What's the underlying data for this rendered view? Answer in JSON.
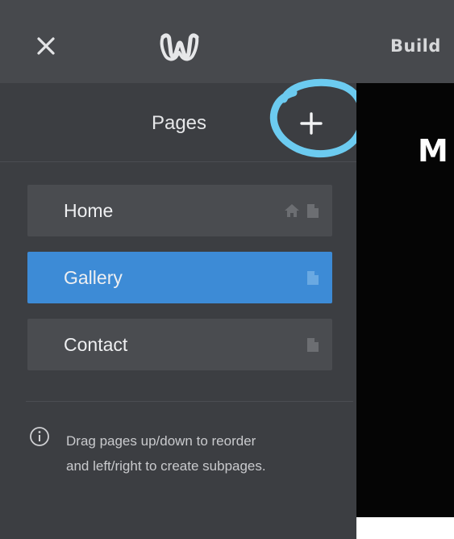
{
  "topbar": {
    "close_icon": "close-icon",
    "logo_icon": "weebly-logo-icon",
    "build_tab_label": "Build"
  },
  "sidebar": {
    "title": "Pages",
    "add_icon": "plus-icon",
    "pages": [
      {
        "label": "Home",
        "icons": [
          "home-icon",
          "page-icon"
        ],
        "active": false
      },
      {
        "label": "Gallery",
        "icons": [
          "page-icon"
        ],
        "active": true
      },
      {
        "label": "Contact",
        "icons": [
          "page-icon"
        ],
        "active": false
      }
    ],
    "help_line_1": "Drag pages up/down to reorder",
    "help_line_2": "and left/right to create subpages.",
    "info_icon": "info-icon"
  },
  "canvas": {
    "title_fragment": "M"
  },
  "colors": {
    "topbar": "#47494d",
    "sidebar": "#3c3e42",
    "item": "#4a4c50",
    "active_item": "#3d8bd6",
    "annotation": "#6ccbf0"
  }
}
